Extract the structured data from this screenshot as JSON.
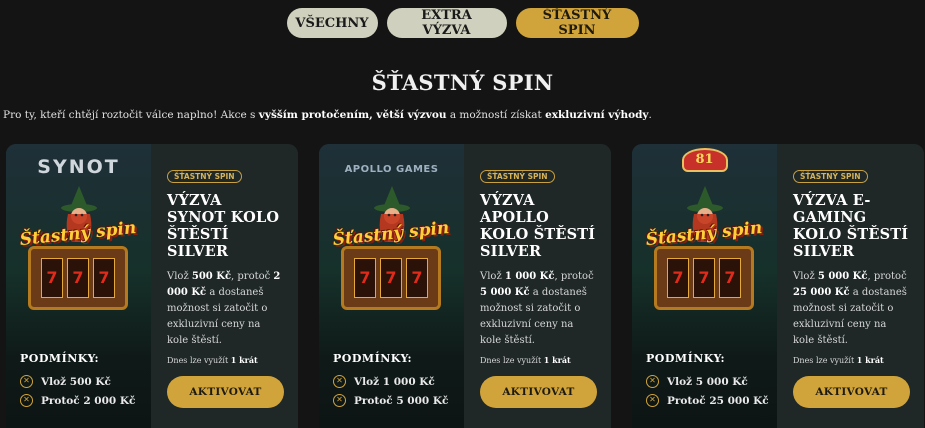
{
  "filters": [
    {
      "label": "VŠECHNY",
      "active": false
    },
    {
      "label": "EXTRA VÝZVA",
      "active": false
    },
    {
      "label": "ŠŤASTNÝ SPIN",
      "active": true
    }
  ],
  "section_title": "ŠŤASTNÝ SPIN",
  "intro": {
    "part1": "Pro ty, kteří chtějí roztočit válce naplno!  Akce s ",
    "bold1": "vyšším protočením, větší výzvou",
    "part2": " a možností získat ",
    "bold2": "exkluzivní výhody",
    "part3": "."
  },
  "cards": [
    {
      "brand": "SYNOT",
      "logo_text": "Šťastný spin",
      "reels": [
        "7",
        "7",
        "7"
      ],
      "tag": "ŠŤASTNÝ SPIN",
      "title": "VÝZVA SYNOT KOLO ŠTĚSTÍ SILVER",
      "desc_pre": "Vlož ",
      "desc_amount": "500 Kč",
      "desc_mid": ", protoč ",
      "desc_turnover": "2 000 Kč",
      "desc_post": " a dostaneš možnost si zatočit o exkluzivní ceny na kole štěstí.",
      "limit_pre": "Dnes lze využít ",
      "limit_count": "1 krát",
      "conditions_title": "PODMÍNKY:",
      "conditions": [
        "Vlož 500 Kč",
        "Protoč 2 000 Kč"
      ],
      "button": "AKTIVOVAT"
    },
    {
      "brand": "APOLLO GAMES",
      "logo_text": "Šťastný spin",
      "reels": [
        "7",
        "7",
        "7"
      ],
      "tag": "ŠŤASTNÝ SPIN",
      "title": "VÝZVA APOLLO KOLO ŠTĚSTÍ SILVER",
      "desc_pre": "Vlož ",
      "desc_amount": "1 000 Kč",
      "desc_mid": ", protoč ",
      "desc_turnover": "5 000 Kč",
      "desc_post": " a dostaneš možnost si zatočit o exkluzivní ceny na kole štěstí.",
      "limit_pre": "Dnes lze využít ",
      "limit_count": "1 krát",
      "conditions_title": "PODMÍNKY:",
      "conditions": [
        "Vlož 1 000 Kč",
        "Protoč 5 000 Kč"
      ],
      "button": "AKTIVOVAT"
    },
    {
      "brand": "81",
      "logo_text": "Šťastný spin",
      "reels": [
        "7",
        "7",
        "7"
      ],
      "tag": "ŠŤASTNÝ SPIN",
      "title": "VÝZVA E-GAMING KOLO ŠTĚSTÍ SILVER",
      "desc_pre": "Vlož ",
      "desc_amount": "5 000 Kč",
      "desc_mid": ", protoč ",
      "desc_turnover": "25 000 Kč",
      "desc_post": " a dostaneš možnost si zatočit o exkluzivní ceny na kole štěstí.",
      "limit_pre": "Dnes lze využít ",
      "limit_count": "1 krát",
      "conditions_title": "PODMÍNKY:",
      "conditions": [
        "Vlož 5 000 Kč",
        "Protoč 25 000 Kč"
      ],
      "button": "AKTIVOVAT"
    }
  ],
  "icons": {
    "condition": "x-circle-icon",
    "witch": "witch-illustration"
  },
  "colors": {
    "accent": "#d0a43a",
    "background": "#141414",
    "card": "#1f2727",
    "filter_inactive": "#cfd0bd"
  }
}
